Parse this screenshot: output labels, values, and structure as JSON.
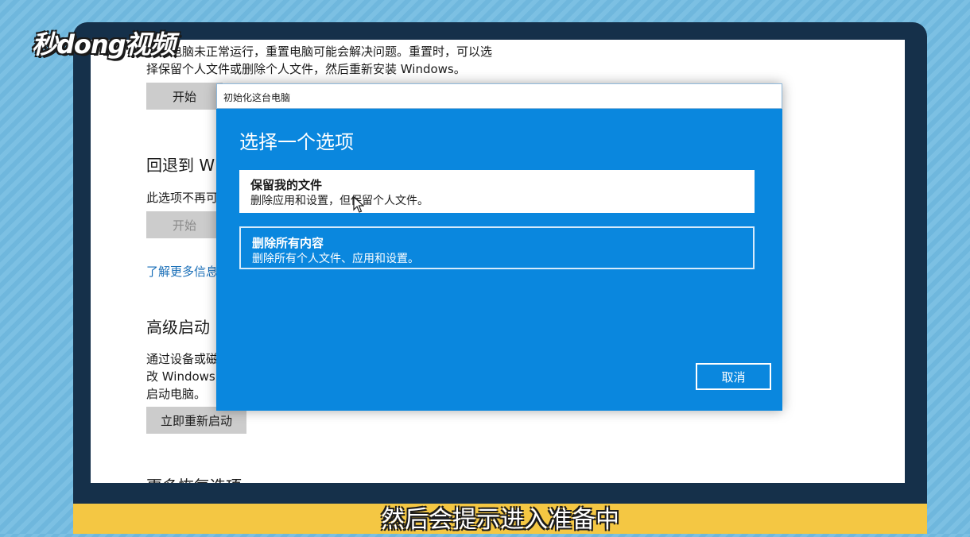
{
  "logo": {
    "text": "秒dong视频"
  },
  "settings": {
    "reset_desc_line1": "电脑未正常运行，重置电脑可能会解决问题。重置时，可以选",
    "reset_desc_line2": "择保留个人文件或删除个人文件，然后重新安装 Windows。",
    "reset_start_label": "开始",
    "goback_heading": "回退到 W",
    "goback_desc": "此选项不再可",
    "goback_start_label": "开始",
    "learn_more": "了解更多信息",
    "advanced_heading": "高级启动",
    "advanced_desc_line1": "通过设备或磁",
    "advanced_desc_line2": "改 Windows",
    "advanced_desc_line3": "启动电脑。",
    "restart_now_label": "立即重新启动",
    "more_recovery_heading": "更多恢复选项"
  },
  "dialog": {
    "title": "初始化这台电脑",
    "heading": "选择一个选项",
    "options": [
      {
        "title": "保留我的文件",
        "desc": "删除应用和设置，但保留个人文件。"
      },
      {
        "title": "删除所有内容",
        "desc": "删除所有个人文件、应用和设置。"
      }
    ],
    "cancel_label": "取消"
  },
  "caption": {
    "text": "然后会提示进入准备中"
  },
  "colors": {
    "dialog_bg": "#0a87de",
    "caption_bar": "#f4c743",
    "bezel": "#15304a"
  }
}
